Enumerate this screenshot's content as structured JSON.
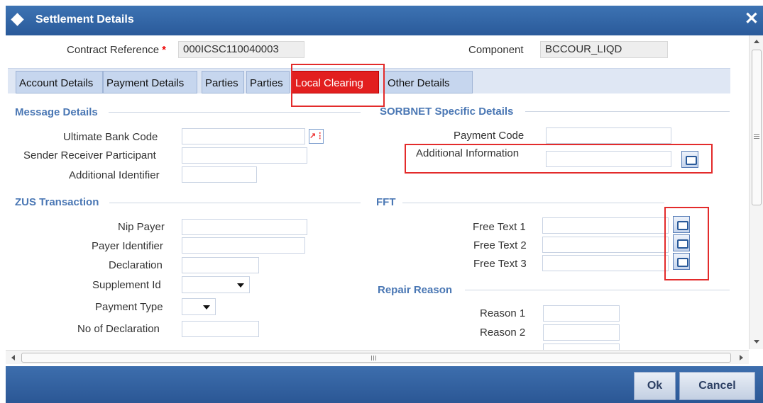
{
  "window": {
    "title": "Settlement Details",
    "close_glyph": "✕"
  },
  "header": {
    "contract_reference_label": "Contract Reference",
    "required_marker": "*",
    "contract_reference_value": "000ICSC110040003",
    "component_label": "Component",
    "component_value": "BCCOUR_LIQD"
  },
  "tabs": [
    {
      "label": "Account Details",
      "active": false
    },
    {
      "label": "Payment Details",
      "active": false
    },
    {
      "label": "Parties",
      "active": false
    },
    {
      "label": "Parties",
      "active": false
    },
    {
      "label": "Local Clearing",
      "active": true
    },
    {
      "label": "Other Details",
      "active": false
    }
  ],
  "message_details": {
    "title": "Message Details",
    "ultimate_bank_code_label": "Ultimate Bank Code",
    "sender_receiver_label": "Sender Receiver Participant",
    "additional_identifier_label": "Additional Identifier"
  },
  "sorbnet": {
    "title": "SORBNET Specific Details",
    "payment_code_label": "Payment Code",
    "additional_information_label": "Additional Information"
  },
  "zus": {
    "title": "ZUS Transaction",
    "nip_payer_label": "Nip Payer",
    "payer_identifier_label": "Payer Identifier",
    "declaration_label": "Declaration",
    "supplement_id_label": "Supplement Id",
    "payment_type_label": "Payment Type",
    "no_of_declaration_label": "No of Declaration"
  },
  "fft": {
    "title": "FFT",
    "free_text_1_label": "Free Text 1",
    "free_text_2_label": "Free Text 2",
    "free_text_3_label": "Free Text 3"
  },
  "repair_reason": {
    "title": "Repair Reason",
    "reason_1_label": "Reason 1",
    "reason_2_label": "Reason 2"
  },
  "footer": {
    "ok_label": "Ok",
    "cancel_label": "Cancel"
  },
  "colors": {
    "title_bar": "#2f62a3",
    "active_tab": "#e21f1f",
    "section_title": "#4a77b4",
    "highlight_box": "#e32b2b"
  },
  "icons": [
    "diamond-icon",
    "close-icon",
    "lov-search-icon",
    "note-icon",
    "dropdown-arrow-icon"
  ]
}
